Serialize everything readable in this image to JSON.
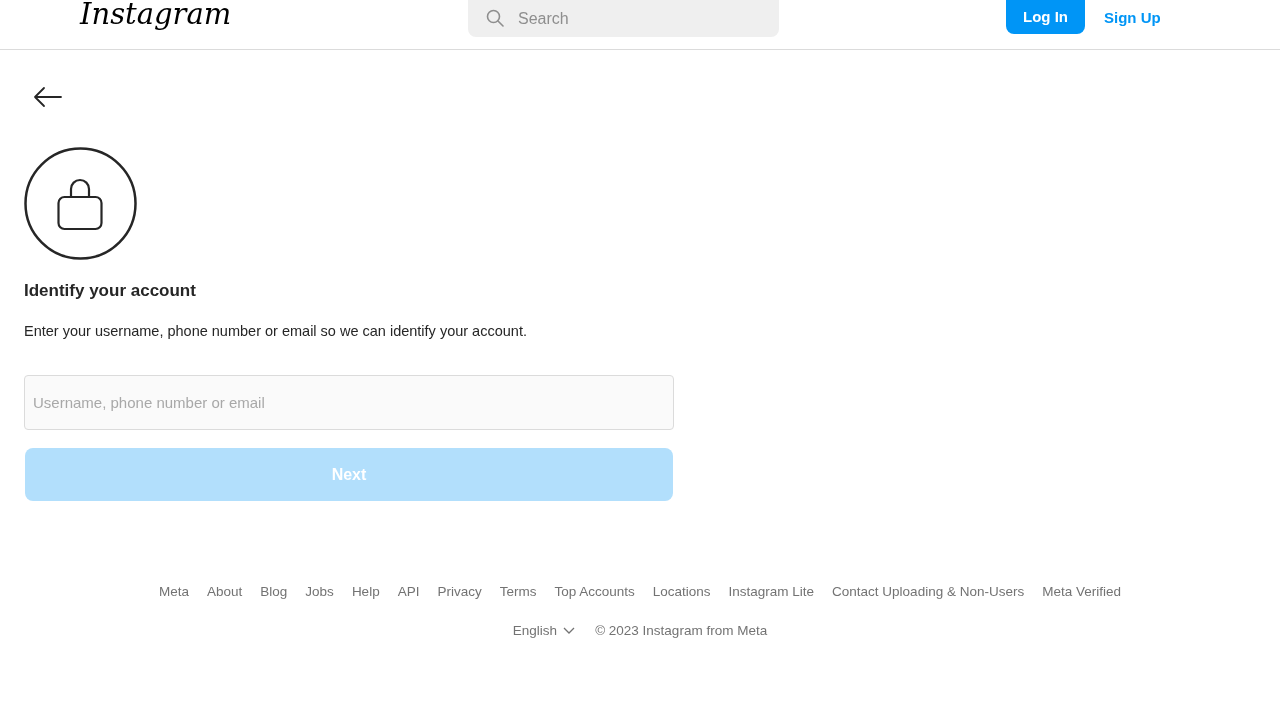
{
  "header": {
    "logo": "Instagram",
    "search": {
      "placeholder": "Search"
    },
    "buttons": [
      {
        "kind": "primary",
        "label": "Log In"
      },
      {
        "kind": "link",
        "label": "Sign Up"
      }
    ]
  },
  "recovery": {
    "title": "Identify your account",
    "description": "Enter your username, phone number or email so we can identify your account.",
    "field": {
      "placeholder": "Username, phone number or email"
    },
    "submit": {
      "label": "Next",
      "disabled": true
    }
  },
  "footer": {
    "links": [
      "Meta",
      "About",
      "Blog",
      "Jobs",
      "Help",
      "API",
      "Privacy",
      "Terms",
      "Top Accounts",
      "Locations",
      "Instagram Lite",
      "Contact Uploading & Non-Users",
      "Meta Verified"
    ],
    "language": "English",
    "copyright": "© 2023 Instagram from Meta"
  }
}
